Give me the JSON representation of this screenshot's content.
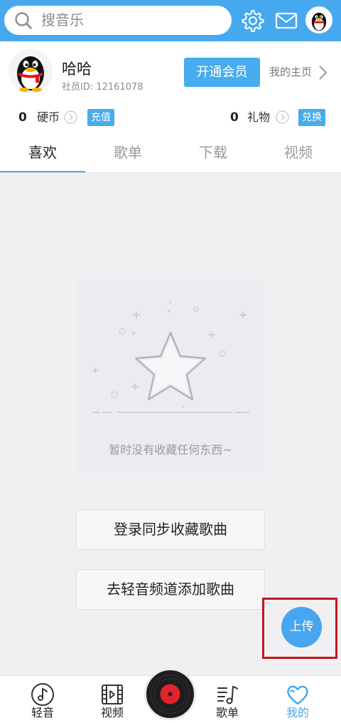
{
  "header": {
    "search_placeholder": "搜音乐",
    "icons": [
      "search-icon",
      "gear-icon",
      "mail-icon",
      "avatar"
    ],
    "accent_color": "#46a9f0"
  },
  "profile": {
    "name": "哈哈",
    "member_id": "社员ID:  12161078",
    "vip_button": "开通会员",
    "homepage_link": "我的主页"
  },
  "wallet": {
    "coins_count": "0",
    "coins_label": "硬币",
    "recharge": "充值",
    "gifts_count": "0",
    "gifts_label": "礼物",
    "exchange": "兑换"
  },
  "tabs": [
    {
      "label": "喜欢",
      "active": true
    },
    {
      "label": "歌单",
      "active": false
    },
    {
      "label": "下载",
      "active": false
    },
    {
      "label": "视频",
      "active": false
    }
  ],
  "empty_state": {
    "message": "暂时没有收藏任何东西~",
    "icon": "star-icon"
  },
  "actions": {
    "login_sync": "登录同步收藏歌曲",
    "add_songs": "去轻音频道添加歌曲"
  },
  "upload": {
    "label": "上传"
  },
  "bottom_nav": [
    {
      "label": "轻音",
      "icon": "music-note-icon",
      "active": false
    },
    {
      "label": "视频",
      "icon": "film-icon",
      "active": false
    },
    {
      "label": "",
      "icon": "vinyl-disc-icon",
      "active": false
    },
    {
      "label": "歌单",
      "icon": "playlist-icon",
      "active": false
    },
    {
      "label": "我的",
      "icon": "heart-icon",
      "active": true
    }
  ]
}
